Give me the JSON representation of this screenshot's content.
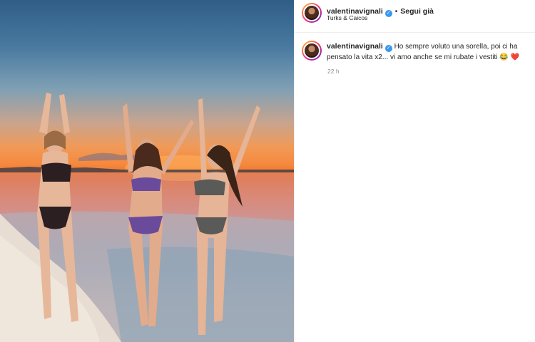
{
  "header": {
    "username": "valentinavignali",
    "verified_symbol": "✓",
    "separator": "•",
    "follow_label": "Segui già",
    "location": "Turks & Caicos"
  },
  "caption": {
    "username": "valentinavignali",
    "text": "Ho sempre voluto una sorella, poi ci ha pensato la vita x2... vi amo anche se mi rubate i vestiti",
    "emoji_laugh": "😂",
    "emoji_heart": "❤️",
    "time": "22 h"
  },
  "icons": {
    "avatar": "profile-avatar",
    "verified": "verified-badge-icon"
  },
  "colors": {
    "verified_blue": "#3897f0",
    "muted_text": "#8e8e8e",
    "primary_text": "#262626"
  }
}
